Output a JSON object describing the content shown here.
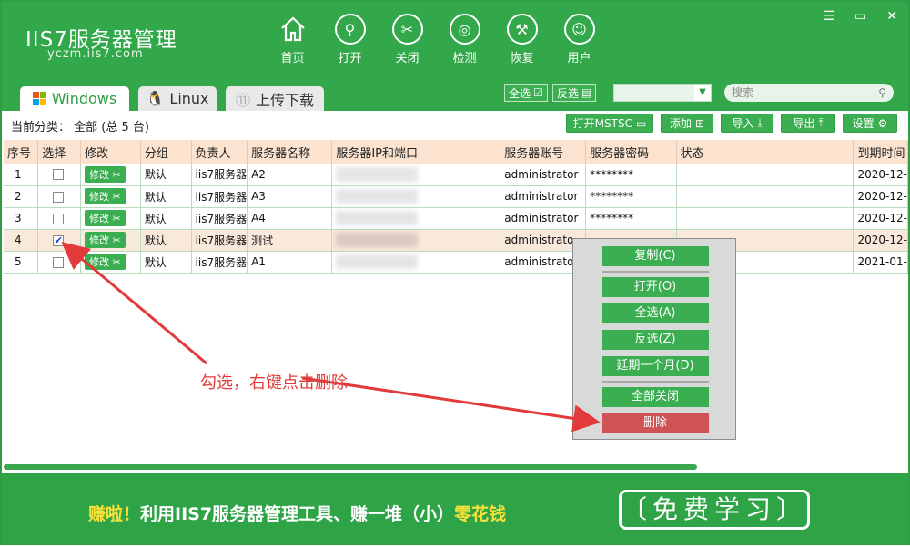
{
  "header": {
    "logo": "IIS7服务器管理",
    "logo_sub": "yczm.iis7.com",
    "nav": [
      {
        "label": "首页",
        "icon": "home-icon"
      },
      {
        "label": "打开",
        "icon": "link-icon"
      },
      {
        "label": "关闭",
        "icon": "unlink-icon"
      },
      {
        "label": "检测",
        "icon": "radar-icon"
      },
      {
        "label": "恢复",
        "icon": "wrench-icon"
      },
      {
        "label": "用户",
        "icon": "user-icon"
      }
    ],
    "window_controls": [
      "menu-icon",
      "minimize-icon",
      "close-icon"
    ]
  },
  "tabs": [
    {
      "label": "Windows",
      "icon": "windows-icon",
      "active": true
    },
    {
      "label": "Linux",
      "icon": "linux-icon",
      "active": false
    },
    {
      "label": "上传下载",
      "icon": "transfer-icon",
      "active": false
    }
  ],
  "selection": {
    "select_all": "全选",
    "invert": "反选"
  },
  "search": {
    "placeholder": "搜索"
  },
  "category": "当前分类： 全部 (总 5 台)",
  "toolbar": {
    "open_mstsc": "打开MSTSC",
    "add": "添加",
    "import": "导入",
    "export": "导出",
    "settings": "设置"
  },
  "table": {
    "columns": [
      "序号",
      "选择",
      "修改",
      "分组",
      "负责人",
      "服务器名称",
      "服务器IP和端口",
      "服务器账号",
      "服务器密码",
      "状态",
      "到期时间"
    ],
    "edit_label": "修改",
    "rows": [
      {
        "no": "1",
        "checked": false,
        "group": "默认",
        "owner": "iis7服务器",
        "name": "A2",
        "account": "administrator",
        "password": "********",
        "expiry": "2020-12-"
      },
      {
        "no": "2",
        "checked": false,
        "group": "默认",
        "owner": "iis7服务器",
        "name": "A3",
        "account": "administrator",
        "password": "********",
        "expiry": "2020-12-"
      },
      {
        "no": "3",
        "checked": false,
        "group": "默认",
        "owner": "iis7服务器",
        "name": "A4",
        "account": "administrator",
        "password": "********",
        "expiry": "2020-12-"
      },
      {
        "no": "4",
        "checked": true,
        "group": "默认",
        "owner": "iis7服务器",
        "name": "测试",
        "account": "administrato",
        "password": "",
        "expiry": "2020-12-"
      },
      {
        "no": "5",
        "checked": false,
        "group": "默认",
        "owner": "iis7服务器",
        "name": "A1",
        "account": "administrato",
        "password": "",
        "expiry": "2021-01-"
      }
    ]
  },
  "context_menu": [
    "复制(C)",
    "打开(O)",
    "全选(A)",
    "反选(Z)",
    "延期一个月(D)",
    "全部关闭",
    "删除"
  ],
  "annotation": "勾选，右键点击删除",
  "footer": {
    "promo_yellow": "赚啦！",
    "promo_white": "利用IIS7服务器管理工具、赚一堆（小）",
    "promo_yellow2": "零花钱",
    "learn_button": "〔免费学习〕"
  },
  "colors": {
    "brand_green": "#33a84a",
    "danger": "#cf5353",
    "annotation_red": "#e23a3a"
  }
}
